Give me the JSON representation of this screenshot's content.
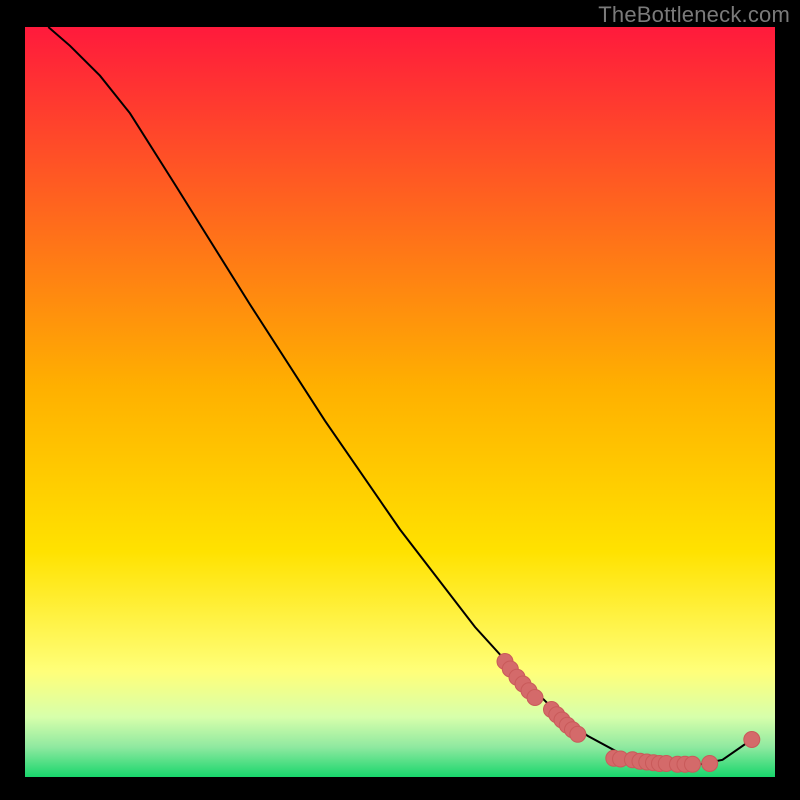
{
  "attribution": "TheBottleneck.com",
  "colors": {
    "bg": "#000000",
    "grad_top": "#ff1a3c",
    "grad_mid": "#ffd400",
    "grad_low": "#ffff7a",
    "grad_band": "#c8ff99",
    "grad_bottom": "#18d66c",
    "curve": "#000000",
    "marker_fill": "#d46a6a",
    "marker_stroke": "#c95a5a",
    "attribution": "#7a7a7a"
  },
  "chart_data": {
    "type": "line",
    "title": "",
    "xlabel": "",
    "ylabel": "",
    "xlim": [
      0,
      100
    ],
    "ylim": [
      0,
      100
    ],
    "curve": [
      {
        "x": 3.1,
        "y": 100.0
      },
      {
        "x": 6.0,
        "y": 97.5
      },
      {
        "x": 10.0,
        "y": 93.5
      },
      {
        "x": 14.0,
        "y": 88.5
      },
      {
        "x": 20.0,
        "y": 79.0
      },
      {
        "x": 30.0,
        "y": 63.0
      },
      {
        "x": 40.0,
        "y": 47.5
      },
      {
        "x": 50.0,
        "y": 33.0
      },
      {
        "x": 60.0,
        "y": 20.0
      },
      {
        "x": 65.0,
        "y": 14.5
      },
      {
        "x": 70.0,
        "y": 9.5
      },
      {
        "x": 75.0,
        "y": 5.5
      },
      {
        "x": 80.0,
        "y": 2.8
      },
      {
        "x": 85.0,
        "y": 1.7
      },
      {
        "x": 90.0,
        "y": 1.7
      },
      {
        "x": 93.0,
        "y": 2.3
      },
      {
        "x": 96.9,
        "y": 5.0
      }
    ],
    "markers": [
      {
        "x": 64.0,
        "y": 15.4
      },
      {
        "x": 64.7,
        "y": 14.4
      },
      {
        "x": 65.6,
        "y": 13.3
      },
      {
        "x": 66.4,
        "y": 12.4
      },
      {
        "x": 67.2,
        "y": 11.5
      },
      {
        "x": 68.0,
        "y": 10.6
      },
      {
        "x": 70.2,
        "y": 9.0
      },
      {
        "x": 70.9,
        "y": 8.3
      },
      {
        "x": 71.6,
        "y": 7.6
      },
      {
        "x": 72.3,
        "y": 6.9
      },
      {
        "x": 73.0,
        "y": 6.3
      },
      {
        "x": 73.7,
        "y": 5.7
      },
      {
        "x": 78.5,
        "y": 2.5
      },
      {
        "x": 79.4,
        "y": 2.4
      },
      {
        "x": 81.0,
        "y": 2.3
      },
      {
        "x": 82.0,
        "y": 2.1
      },
      {
        "x": 82.9,
        "y": 2.0
      },
      {
        "x": 83.8,
        "y": 1.9
      },
      {
        "x": 84.6,
        "y": 1.8
      },
      {
        "x": 85.5,
        "y": 1.8
      },
      {
        "x": 87.0,
        "y": 1.7
      },
      {
        "x": 88.0,
        "y": 1.7
      },
      {
        "x": 89.0,
        "y": 1.7
      },
      {
        "x": 91.3,
        "y": 1.8
      },
      {
        "x": 96.9,
        "y": 5.0
      }
    ]
  }
}
